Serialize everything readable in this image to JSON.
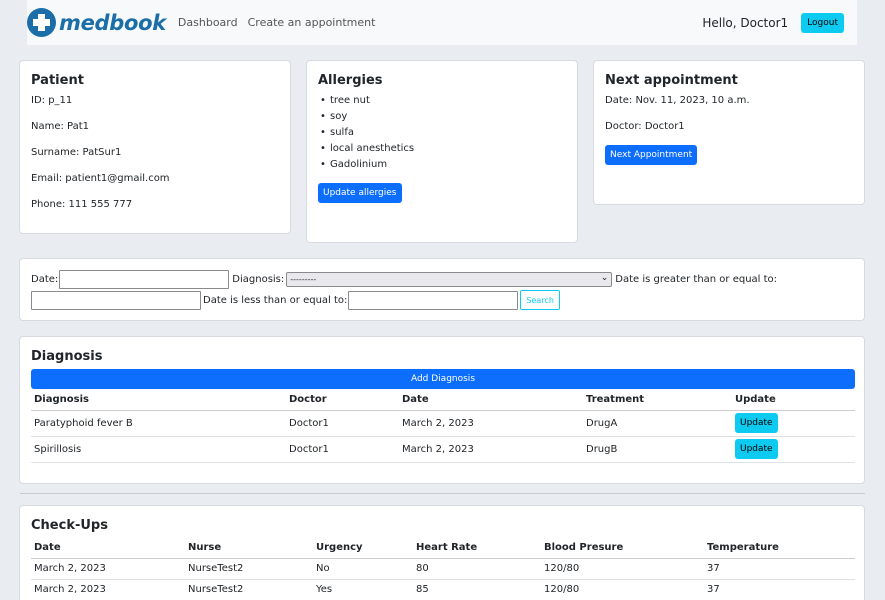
{
  "nav": {
    "brand": "medbook",
    "links": [
      "Dashboard",
      "Create an appointment"
    ],
    "greeting": "Hello, Doctor1",
    "logout_label": "Logout"
  },
  "patient": {
    "title": "Patient",
    "id": "ID: p_11",
    "name": "Name: Pat1",
    "surname": "Surname: PatSur1",
    "email": "Email: patient1@gmail.com",
    "phone": "Phone: 111 555 777"
  },
  "allergies": {
    "title": "Allergies",
    "items": [
      "tree nut",
      "soy",
      "sulfa",
      "local anesthetics",
      "Gadolinium"
    ],
    "update_label": "Update allergies"
  },
  "appointment": {
    "title": "Next appointment",
    "date": "Date: Nov. 11, 2023, 10 a.m.",
    "doctor": "Doctor: Doctor1",
    "button_label": "Next Appointment"
  },
  "filter": {
    "date_label": "Date:",
    "diagnosis_label": "Diagnosis:",
    "diagnosis_selected": "---------",
    "gte_label": "Date is greater than or equal to:",
    "lte_label": "Date is less than or equal to:",
    "search_label": "Search"
  },
  "diagnosis": {
    "title": "Diagnosis",
    "add_label": "Add Diagnosis",
    "columns": [
      "Diagnosis",
      "Doctor",
      "Date",
      "Treatment",
      "Update"
    ],
    "rows": [
      {
        "diagnosis": "Paratyphoid fever B",
        "doctor": "Doctor1",
        "date": "March 2, 2023",
        "treatment": "DrugA",
        "update": "Update"
      },
      {
        "diagnosis": "Spirillosis",
        "doctor": "Doctor1",
        "date": "March 2, 2023",
        "treatment": "DrugB",
        "update": "Update"
      }
    ]
  },
  "checkups": {
    "title": "Check-Ups",
    "columns": [
      "Date",
      "Nurse",
      "Urgency",
      "Heart Rate",
      "Blood Presure",
      "Temperature"
    ],
    "rows": [
      {
        "date": "March 2, 2023",
        "nurse": "NurseTest2",
        "urgency": "No",
        "heart_rate": "80",
        "blood_pressure": "120/80",
        "temperature": "37"
      },
      {
        "date": "March 2, 2023",
        "nurse": "NurseTest2",
        "urgency": "Yes",
        "heart_rate": "85",
        "blood_pressure": "120/80",
        "temperature": "37"
      }
    ]
  },
  "colors": {
    "primary": "#0d6efd",
    "info": "#0dcaf0",
    "brand": "#1b6ea8"
  }
}
